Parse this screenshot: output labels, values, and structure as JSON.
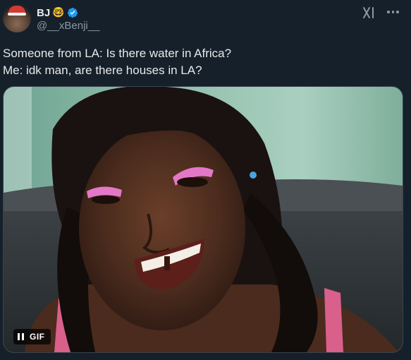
{
  "author": {
    "display_name": "BJ",
    "name_emoji": "🤓",
    "handle": "@__xBenji__",
    "verified": true
  },
  "header_icons": [
    "grok-icon",
    "more-icon"
  ],
  "tweet": {
    "lines": [
      "Someone from LA: Is there water in Africa?",
      "Me: idk man, are there houses in LA?"
    ]
  },
  "media": {
    "type": "GIF",
    "badge_label": "GIF",
    "control": "pause"
  },
  "colors": {
    "background": "#15202b",
    "text": "#e7e9ea",
    "secondary_text": "#8b98a5",
    "verified_blue": "#1d9bf0"
  }
}
